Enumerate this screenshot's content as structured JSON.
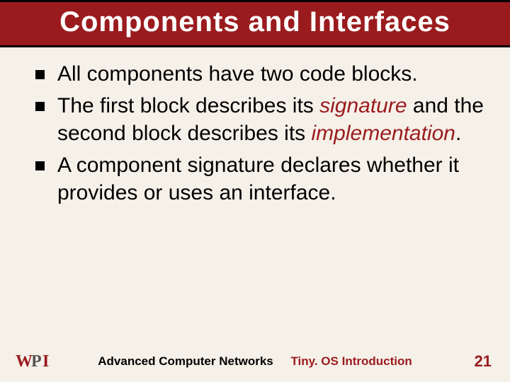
{
  "title": "Components and Interfaces",
  "bullets": {
    "b0": "All components have two code blocks.",
    "b1_pre": "The first block describes its ",
    "b1_kw1": "signature",
    "b1_mid": " and the second block describes its ",
    "b1_kw2": "implementation",
    "b1_post": ".",
    "b2": "A component signature declares whether it provides or uses an interface."
  },
  "footer": {
    "course": "Advanced Computer Networks",
    "topic": "Tiny. OS Introduction",
    "page": "21"
  },
  "logo_alt": "WPI"
}
